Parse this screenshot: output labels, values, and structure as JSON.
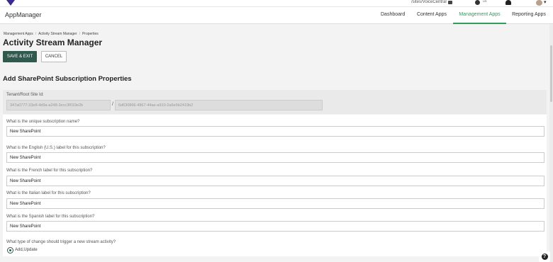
{
  "top_bar": {
    "site_path": "/sites/VoiceCentral",
    "language": "US",
    "icons": [
      "logo-icon",
      "printer-icon",
      "globe-icon",
      "bell-icon",
      "avatar",
      "chevron-down-icon"
    ]
  },
  "navbar": {
    "app_title": "AppManager",
    "tabs": [
      {
        "label": "Dashboard",
        "active": false
      },
      {
        "label": "Content Apps",
        "active": false
      },
      {
        "label": "Management Apps",
        "active": true
      },
      {
        "label": "Reporting Apps",
        "active": false
      }
    ]
  },
  "breadcrumb": {
    "items": [
      "Management Apps",
      "Activity Stream Manager",
      "Properties"
    ]
  },
  "page_title": "Activity Stream Manager",
  "actions": {
    "save_exit": "SAVE & EXIT",
    "cancel": "CANCEL"
  },
  "section_title": "Add SharePoint Subscription Properties",
  "site_id": {
    "label": "Tenant/Root Site Id:",
    "tenant_value": "347a0777-33e8-4d9a-a248-3ecc3f019e2b",
    "separator": "/",
    "root_site_value": "6d630866-4867-44ae-a910-2a6e6b2419b2"
  },
  "questions": [
    {
      "label": "What is the unique subscription name?",
      "value": "New SharePoint"
    },
    {
      "label": "What is the English (U.S.) label for this subscription?",
      "value": "New SharePoint"
    },
    {
      "label": "What is the French label for this subscription?",
      "value": "New SharePoint"
    },
    {
      "label": "What is the Italian label for this subscription?",
      "value": "New SharePoint"
    },
    {
      "label": "What is the Spanish label for this subscription?",
      "value": "New SharePoint"
    }
  ],
  "trigger": {
    "label": "What type of change should trigger a new stream activity?",
    "selected_option": "Add,Update"
  },
  "help": {
    "glyph": "?"
  },
  "colors": {
    "accent_green": "#2e9e58",
    "button_dark": "#2f5a4d",
    "page_background": "#f3f3f3"
  }
}
